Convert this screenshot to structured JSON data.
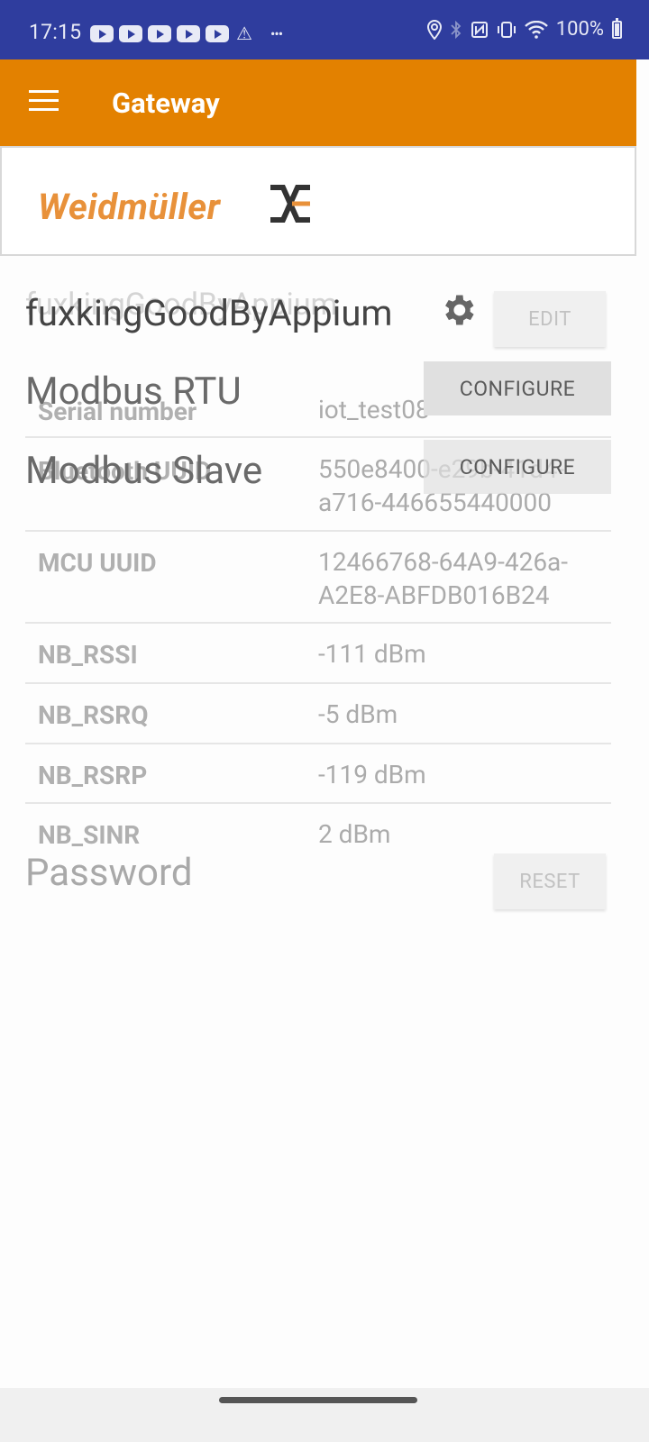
{
  "status_bar": {
    "time": "17:15",
    "battery": "100%",
    "icons": [
      "youtube-icon",
      "youtube-icon",
      "youtube-icon",
      "youtube-icon",
      "youtube-icon",
      "warning-icon",
      "more-icon",
      "location-icon",
      "bluetooth-icon",
      "nfc-icon",
      "vibrate-icon",
      "wifi-icon",
      "battery-icon"
    ]
  },
  "app_bar": {
    "title": "Gateway"
  },
  "brand": {
    "logo_text": "Weidmüller",
    "logo_color": "#e8913a"
  },
  "gateway": {
    "name": "fuxkingGoodByAppium",
    "ghost_name": "fuxkingGoodByAppium",
    "edit_label": "EDIT"
  },
  "sections": {
    "modbus_rtu": {
      "label": "Modbus RTU",
      "button": "CONFIGURE"
    },
    "modbus_slave": {
      "label": "Modbus Slave",
      "button": "CONFIGURE"
    }
  },
  "info_rows": [
    {
      "key": "Serial number",
      "value": "iot_test08"
    },
    {
      "key": "Bluetooth UUID",
      "value": "550e8400-e29b-41d4-a716-446655440000"
    },
    {
      "key": "MCU UUID",
      "value": "12466768-64A9-426a-A2E8-ABFDB016B24"
    },
    {
      "key": "NB_RSSI",
      "value": "-111 dBm"
    },
    {
      "key": "NB_RSRQ",
      "value": "-5 dBm"
    },
    {
      "key": "NB_RSRP",
      "value": "-119 dBm"
    },
    {
      "key": "NB_SINR",
      "value": "2 dBm"
    }
  ],
  "password": {
    "label": "Password",
    "reset_label": "RESET"
  },
  "colors": {
    "status_bar": "#2f3d9e",
    "app_bar": "#e38100"
  }
}
